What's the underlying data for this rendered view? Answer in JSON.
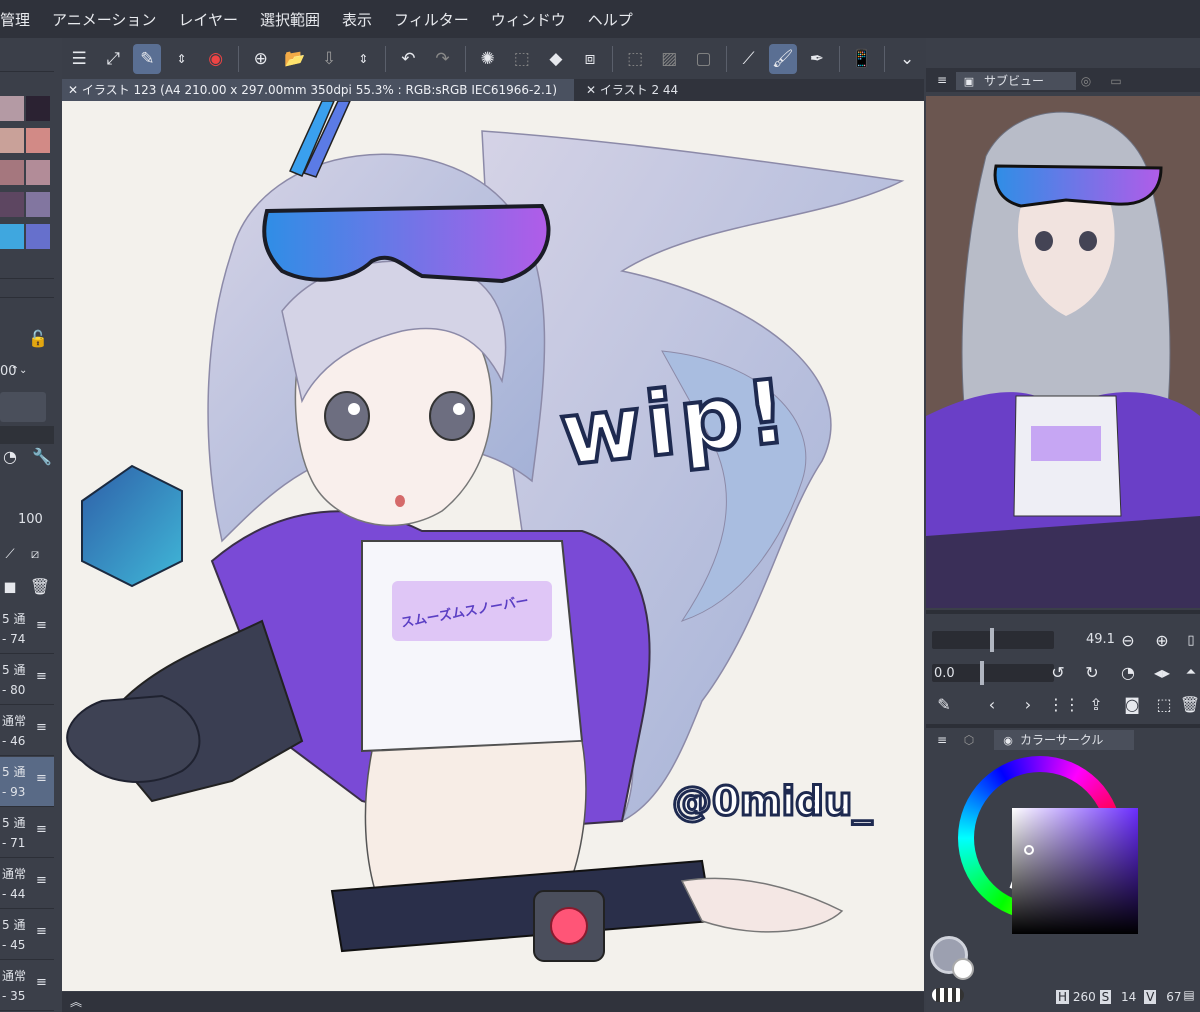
{
  "menu": [
    "管理",
    "アニメーション",
    "レイヤー",
    "選択範囲",
    "表示",
    "フィルター",
    "ウィンドウ",
    "ヘルプ"
  ],
  "toolbar_icons": [
    "menu-icon",
    "resize-icon",
    "eyedropper-brush-icon",
    "up-down-icon",
    "record-icon",
    "new-canvas-icon",
    "open-folder-icon",
    "save-icon",
    "stepper-icon",
    "undo-icon",
    "redo-icon",
    "loading-icon",
    "select-all-icon",
    "fill-icon",
    "transform-icon",
    "deselect-icon",
    "invert-selection-icon",
    "selection-border-icon",
    "ruler-line-icon",
    "ruler-brush-icon",
    "ruler-pen-icon",
    "smartphone-icon",
    "chevron-down-icon"
  ],
  "tabs": {
    "active": "イラスト 123 (A4 210.00 x 297.00mm 350dpi 55.3% : RGB:sRGB IEC61966-2.1)",
    "second": "イラスト 2 44"
  },
  "canvas": {
    "wip_text": "wip!",
    "signature": "@0midu_",
    "shirt_logo": "スムーズムスノーバー"
  },
  "left": {
    "value_top": "00",
    "opacity": "100",
    "layers": [
      {
        "mode": "5 通",
        "value": "- 74"
      },
      {
        "mode": "5 通",
        "value": "- 80"
      },
      {
        "mode": "通常",
        "value": "- 46"
      },
      {
        "mode": "5 通",
        "value": "- 93"
      },
      {
        "mode": "5 通",
        "value": "- 71"
      },
      {
        "mode": "通常",
        "value": "- 44"
      },
      {
        "mode": "5 通",
        "value": "- 45"
      },
      {
        "mode": "通常",
        "value": "- 35"
      }
    ]
  },
  "subview": {
    "title": "サブビュー"
  },
  "nav": {
    "zoom": "49.1",
    "angle": "0.0"
  },
  "color_panel": {
    "title": "カラーサークル",
    "h_label": "H",
    "h": "260",
    "s_label": "S",
    "s": "14",
    "v_label": "V",
    "v": "67"
  },
  "colors": {
    "accent": "#5a6f93",
    "panel": "#3b3f49",
    "selected_color": "#9ca0b0"
  }
}
